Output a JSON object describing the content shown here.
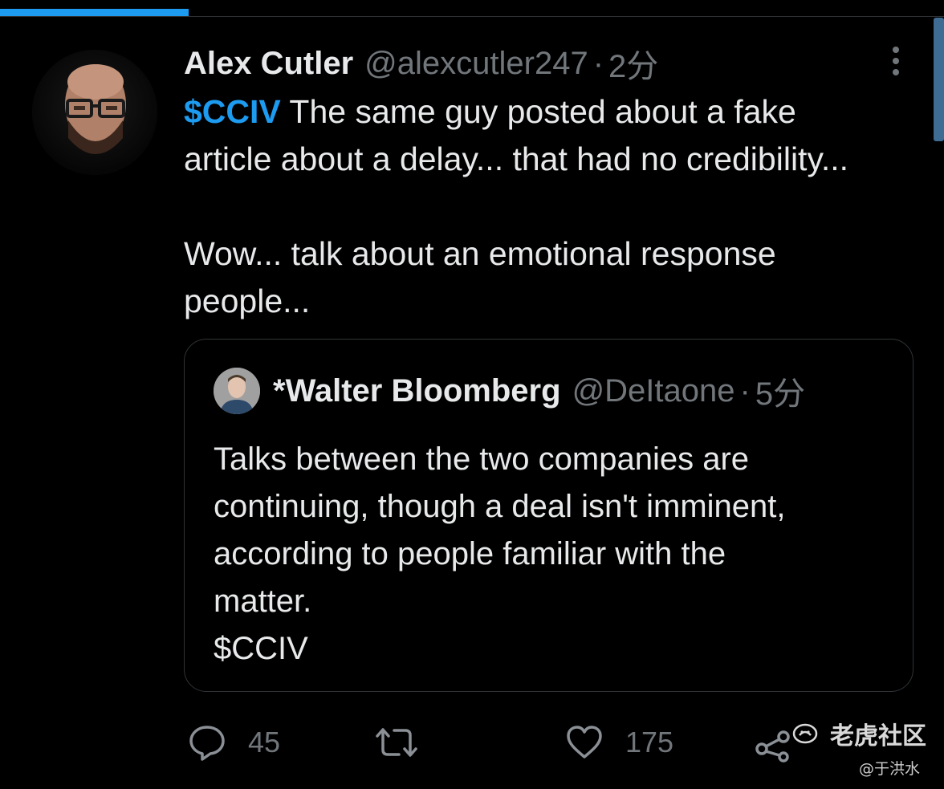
{
  "tweet": {
    "author_name": "Alex Cutler",
    "handle": "@alexcutler247",
    "separator": "·",
    "time": "2分",
    "cashtag": "$CCIV",
    "lines": [
      " The same guy posted about a fake",
      "article about a delay... that had no credibility...",
      "",
      "Wow... talk about an emotional response",
      "people..."
    ]
  },
  "quote": {
    "author_name": "*Walter Bloomberg",
    "handle": "@DeItaone",
    "separator": "·",
    "time": "5分",
    "lines": [
      "Talks between the two companies are",
      "continuing, though a deal isn't imminent,",
      "according to people familiar with the",
      "matter.",
      "$CCIV"
    ]
  },
  "actions": {
    "reply_count": "45",
    "retweet_count": "",
    "like_count": "175"
  },
  "watermark": {
    "brand": "老虎社区",
    "user": "@于洪水"
  },
  "colors": {
    "background": "#000000",
    "accent": "#1d9bf0",
    "text": "#e7e9ea",
    "muted": "#71767b",
    "border": "#2f3336"
  },
  "icons": [
    "more-vertical-icon",
    "reply-icon",
    "retweet-icon",
    "like-icon",
    "share-icon",
    "tiger-logo-icon"
  ]
}
